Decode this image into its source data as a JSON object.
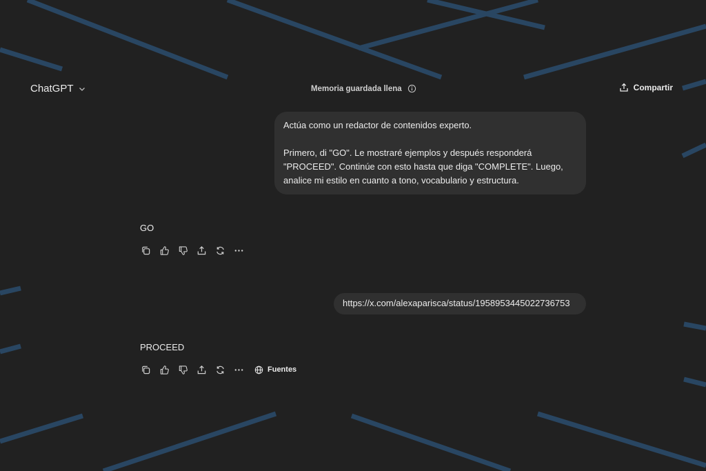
{
  "header": {
    "model_label": "ChatGPT",
    "memory_status": "Memoria guardada llena",
    "share_label": "Compartir"
  },
  "conversation": {
    "user_message_1": {
      "line_1": "Actúa como un redactor de contenidos experto.",
      "line_2": "Primero, di \"GO\". Le mostraré ejemplos y después responderá \"PROCEED\". Continúe con esto hasta que diga \"COMPLETE\". Luego, analice mi estilo en cuanto a tono, vocabulario y estructura."
    },
    "assistant_message_1": "GO",
    "user_message_2": "https://x.com/alexaparisca/status/1958953445022736753",
    "assistant_message_2": "PROCEED",
    "sources_label": "Fuentes"
  },
  "icons": {
    "model_menu": "chevron-down-icon",
    "memory_info": "info-icon",
    "share": "share-icon",
    "copy": "copy-icon",
    "good": "thumbs-up-icon",
    "bad": "thumbs-down-icon",
    "share_msg": "share-icon",
    "regenerate": "regenerate-icon",
    "more": "more-icon",
    "sources": "globe-icon"
  },
  "colors": {
    "background": "#212121",
    "bubble": "#303030",
    "text": "#ececec",
    "streak": "#2b4d6e"
  }
}
